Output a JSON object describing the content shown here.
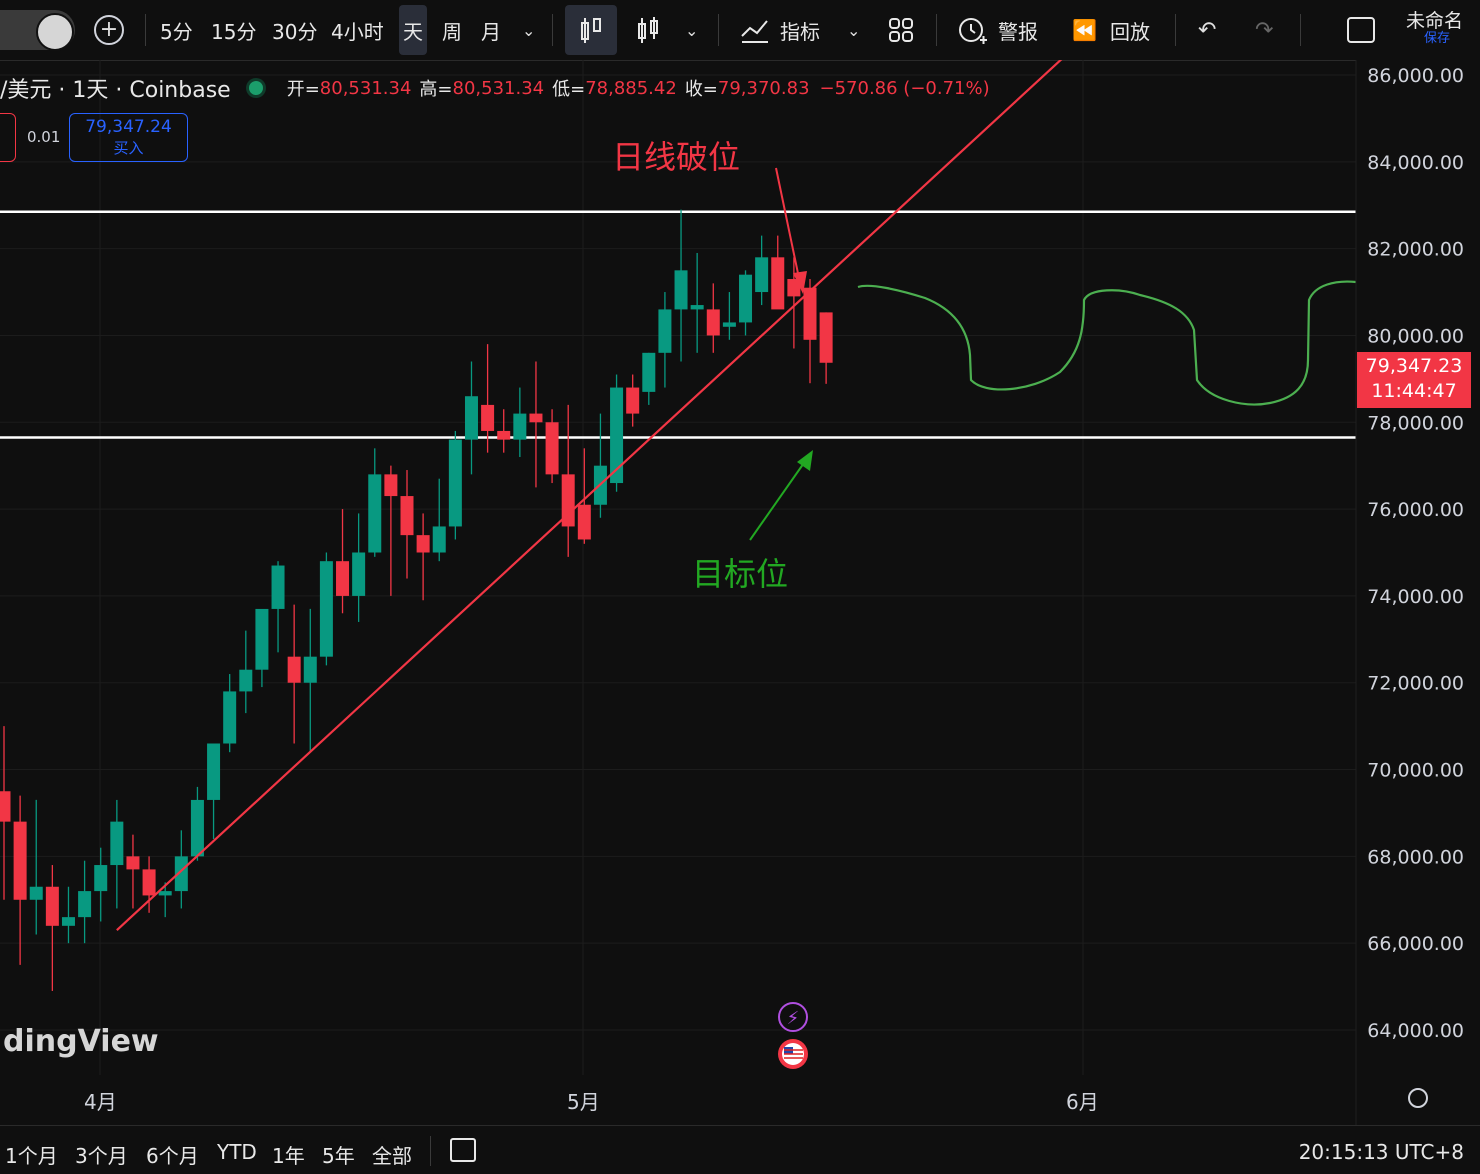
{
  "toolbar": {
    "add_symbol": "+",
    "intervals": [
      "5分",
      "15分",
      "30分",
      "4小时",
      "天",
      "周",
      "月"
    ],
    "active_interval": "天",
    "indicators_label": "指标",
    "alerts_label": "警报",
    "replay_label": "回放",
    "layout_name": "未命名",
    "save_label": "保存"
  },
  "legend": {
    "symbol": "/美元 · 1天 · Coinbase",
    "open_label": "开=",
    "open": "80,531.34",
    "high_label": "高=",
    "high": "80,531.34",
    "low_label": "低=",
    "low": "78,885.42",
    "close_label": "收=",
    "close": "79,370.83",
    "change": "−570.86 (−0.71%)"
  },
  "trade": {
    "spread": "0.01",
    "buy_price": "79,347.24",
    "buy_label": "买入"
  },
  "price_badge": {
    "price": "79,347.23",
    "countdown": "11:44:47"
  },
  "watermark": "dingView",
  "bottom": {
    "ranges": [
      "1个月",
      "3个月",
      "6个月",
      "YTD",
      "1年",
      "5年",
      "全部"
    ],
    "clock": "20:15:13 UTC+8"
  },
  "colors": {
    "up": "#089981",
    "down": "#f23645",
    "background": "#0f0f0f"
  },
  "chart_data": {
    "type": "candlestick",
    "y_range": [
      63000,
      86500
    ],
    "y_ticks": [
      86000,
      84000,
      82000,
      80000,
      78000,
      76000,
      74000,
      72000,
      70000,
      68000,
      66000,
      64000
    ],
    "y_tick_labels": [
      "86,000.00",
      "84,000.00",
      "82,000.00",
      "80,000.00",
      "78,000.00",
      "76,000.00",
      "74,000.00",
      "72,000.00",
      "70,000.00",
      "68,000.00",
      "66,000.00",
      "64,000.00"
    ],
    "x_labels": [
      "4月",
      "5月",
      "6月"
    ],
    "candles": [
      {
        "o": 69500,
        "h": 71000,
        "l": 67000,
        "c": 68800
      },
      {
        "o": 68800,
        "h": 69400,
        "l": 65500,
        "c": 67000
      },
      {
        "o": 67000,
        "h": 69300,
        "l": 66200,
        "c": 67300
      },
      {
        "o": 67300,
        "h": 67800,
        "l": 64900,
        "c": 66400
      },
      {
        "o": 66400,
        "h": 67300,
        "l": 66000,
        "c": 66600
      },
      {
        "o": 66600,
        "h": 67900,
        "l": 66000,
        "c": 67200
      },
      {
        "o": 67200,
        "h": 68200,
        "l": 66500,
        "c": 67800
      },
      {
        "o": 67800,
        "h": 69300,
        "l": 66800,
        "c": 68800
      },
      {
        "o": 68000,
        "h": 68500,
        "l": 66800,
        "c": 67700
      },
      {
        "o": 67700,
        "h": 68000,
        "l": 66700,
        "c": 67100
      },
      {
        "o": 67100,
        "h": 67400,
        "l": 66600,
        "c": 67200
      },
      {
        "o": 67200,
        "h": 68600,
        "l": 66800,
        "c": 68000
      },
      {
        "o": 68000,
        "h": 69600,
        "l": 67900,
        "c": 69300
      },
      {
        "o": 69300,
        "h": 70600,
        "l": 68400,
        "c": 70600
      },
      {
        "o": 70600,
        "h": 72200,
        "l": 70400,
        "c": 71800
      },
      {
        "o": 71800,
        "h": 73200,
        "l": 71300,
        "c": 72300
      },
      {
        "o": 72300,
        "h": 73500,
        "l": 71900,
        "c": 73700
      },
      {
        "o": 73700,
        "h": 74800,
        "l": 72700,
        "c": 74700
      },
      {
        "o": 72600,
        "h": 73800,
        "l": 70600,
        "c": 72000
      },
      {
        "o": 72000,
        "h": 73700,
        "l": 70400,
        "c": 72600
      },
      {
        "o": 72600,
        "h": 75000,
        "l": 72400,
        "c": 74800
      },
      {
        "o": 74800,
        "h": 76000,
        "l": 73600,
        "c": 74000
      },
      {
        "o": 74000,
        "h": 75900,
        "l": 73400,
        "c": 75000
      },
      {
        "o": 75000,
        "h": 77400,
        "l": 74900,
        "c": 76800
      },
      {
        "o": 76800,
        "h": 77000,
        "l": 74000,
        "c": 76300
      },
      {
        "o": 76300,
        "h": 76900,
        "l": 74400,
        "c": 75400
      },
      {
        "o": 75400,
        "h": 75900,
        "l": 73900,
        "c": 75000
      },
      {
        "o": 75000,
        "h": 76700,
        "l": 74800,
        "c": 75600
      },
      {
        "o": 75600,
        "h": 77800,
        "l": 75300,
        "c": 77600
      },
      {
        "o": 77600,
        "h": 79400,
        "l": 76800,
        "c": 78600
      },
      {
        "o": 78400,
        "h": 79800,
        "l": 77300,
        "c": 77800
      },
      {
        "o": 77800,
        "h": 78300,
        "l": 77300,
        "c": 77600
      },
      {
        "o": 77600,
        "h": 78800,
        "l": 77200,
        "c": 78200
      },
      {
        "o": 78200,
        "h": 79400,
        "l": 76500,
        "c": 78000
      },
      {
        "o": 78000,
        "h": 78300,
        "l": 76600,
        "c": 76800
      },
      {
        "o": 76800,
        "h": 78400,
        "l": 74900,
        "c": 75600
      },
      {
        "o": 76100,
        "h": 77400,
        "l": 75200,
        "c": 75300
      },
      {
        "o": 76100,
        "h": 78200,
        "l": 75800,
        "c": 77000
      },
      {
        "o": 76600,
        "h": 79100,
        "l": 76400,
        "c": 78800
      },
      {
        "o": 78800,
        "h": 79100,
        "l": 77900,
        "c": 78200
      },
      {
        "o": 78700,
        "h": 79600,
        "l": 78400,
        "c": 79600
      },
      {
        "o": 79600,
        "h": 81000,
        "l": 78800,
        "c": 80600
      },
      {
        "o": 80600,
        "h": 82900,
        "l": 79400,
        "c": 81500
      },
      {
        "o": 80600,
        "h": 81900,
        "l": 79600,
        "c": 80700
      },
      {
        "o": 80600,
        "h": 81200,
        "l": 79600,
        "c": 80000
      },
      {
        "o": 80200,
        "h": 81000,
        "l": 79900,
        "c": 80300
      },
      {
        "o": 80300,
        "h": 81500,
        "l": 80000,
        "c": 81400
      },
      {
        "o": 81000,
        "h": 82300,
        "l": 80700,
        "c": 81800
      },
      {
        "o": 81800,
        "h": 82300,
        "l": 80800,
        "c": 80600
      },
      {
        "o": 81300,
        "h": 81800,
        "l": 79700,
        "c": 80900
      },
      {
        "o": 81100,
        "h": 81300,
        "l": 78900,
        "c": 79900
      },
      {
        "o": 80531.34,
        "h": 80531.34,
        "l": 78885.42,
        "c": 79370.83
      }
    ],
    "horizontal_lines": [
      82850,
      77650
    ],
    "trendline": {
      "from_index": 7,
      "from_price": 66300,
      "to_index": 66,
      "to_price": 86500
    },
    "annotations": [
      {
        "text": "日线破位",
        "color": "#f23645"
      },
      {
        "text": "目标位",
        "color": "#22a822"
      }
    ],
    "projection_color": "#4caf50"
  }
}
